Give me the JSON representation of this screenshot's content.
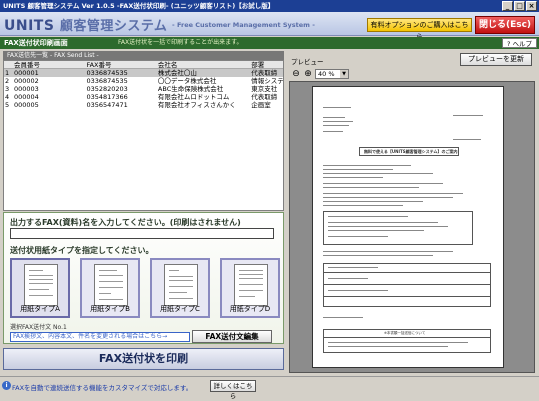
{
  "window": {
    "title": "UNITS 顧客管理システム  Ver 1.0.5 -FAX送付状印刷- (ユニッツ顧客リスト)【お試し版】",
    "min": "_",
    "max": "□",
    "close": "×"
  },
  "header": {
    "logo": "UNITS",
    "logo_jp": "顧客管理システム",
    "subtitle": "- Free Customer Management System -",
    "buy_label": "有料オプションのご購入はこちら",
    "close_label": "閉じる(Esc)"
  },
  "subbar": {
    "title": "FAX送付状印刷画面",
    "note": "FAX送付状を一括で印刷することが出来ます。",
    "help": "ヘルプ"
  },
  "list": {
    "header": "FAX送信先一覧 - FAX Send List -",
    "columns": [
      "会員番号",
      "FAX番号",
      "会社名",
      "部署"
    ],
    "rows": [
      {
        "idx": "1",
        "id": "000001",
        "fax": "0336874535",
        "company": "株式会社〇山",
        "dept": "代表取締"
      },
      {
        "idx": "2",
        "id": "000002",
        "fax": "0336874535",
        "company": "〇〇データ株式会社",
        "dept": "情報システ"
      },
      {
        "idx": "3",
        "id": "000003",
        "fax": "0352820203",
        "company": "ABC生命保険株式会社",
        "dept": "東京支社"
      },
      {
        "idx": "4",
        "id": "000004",
        "fax": "0354817366",
        "company": "有限会社ムロドットコム",
        "dept": "代表取締"
      },
      {
        "idx": "5",
        "id": "000005",
        "fax": "0356547471",
        "company": "有限会社オフィスさんかく",
        "dept": "企画室"
      }
    ]
  },
  "form": {
    "fax_name_label": "出力するFAX(資料)名を入力してください。(印刷はされません)",
    "fax_name_value": "",
    "paper_type_label": "送付状用紙タイプを指定してください。",
    "types": [
      "用紙タイプA",
      "用紙タイプB",
      "用紙タイプC",
      "用紙タイプD"
    ],
    "selected_type": "用紙タイプA",
    "selected_note": "選択FAX送付文 No.1",
    "faq_link": "FAX挨拶文、内容本文、件名を変更される場合はこちら→",
    "edit_button": "FAX送付文編集",
    "print_button": "FAX送付状を印刷"
  },
  "preview": {
    "label": "プレビュー",
    "refresh_button": "プレビューを更新",
    "zoom": "40 %",
    "doc_title": "無料で使える【UNITS顧客管理システム】のご案内",
    "doc_footer": "※本書類一括送信について"
  },
  "status": {
    "link_text": "FAXを自動で連続送信する機能をカスタマイズで対応します。",
    "detail_button": "詳しくはこちら"
  }
}
